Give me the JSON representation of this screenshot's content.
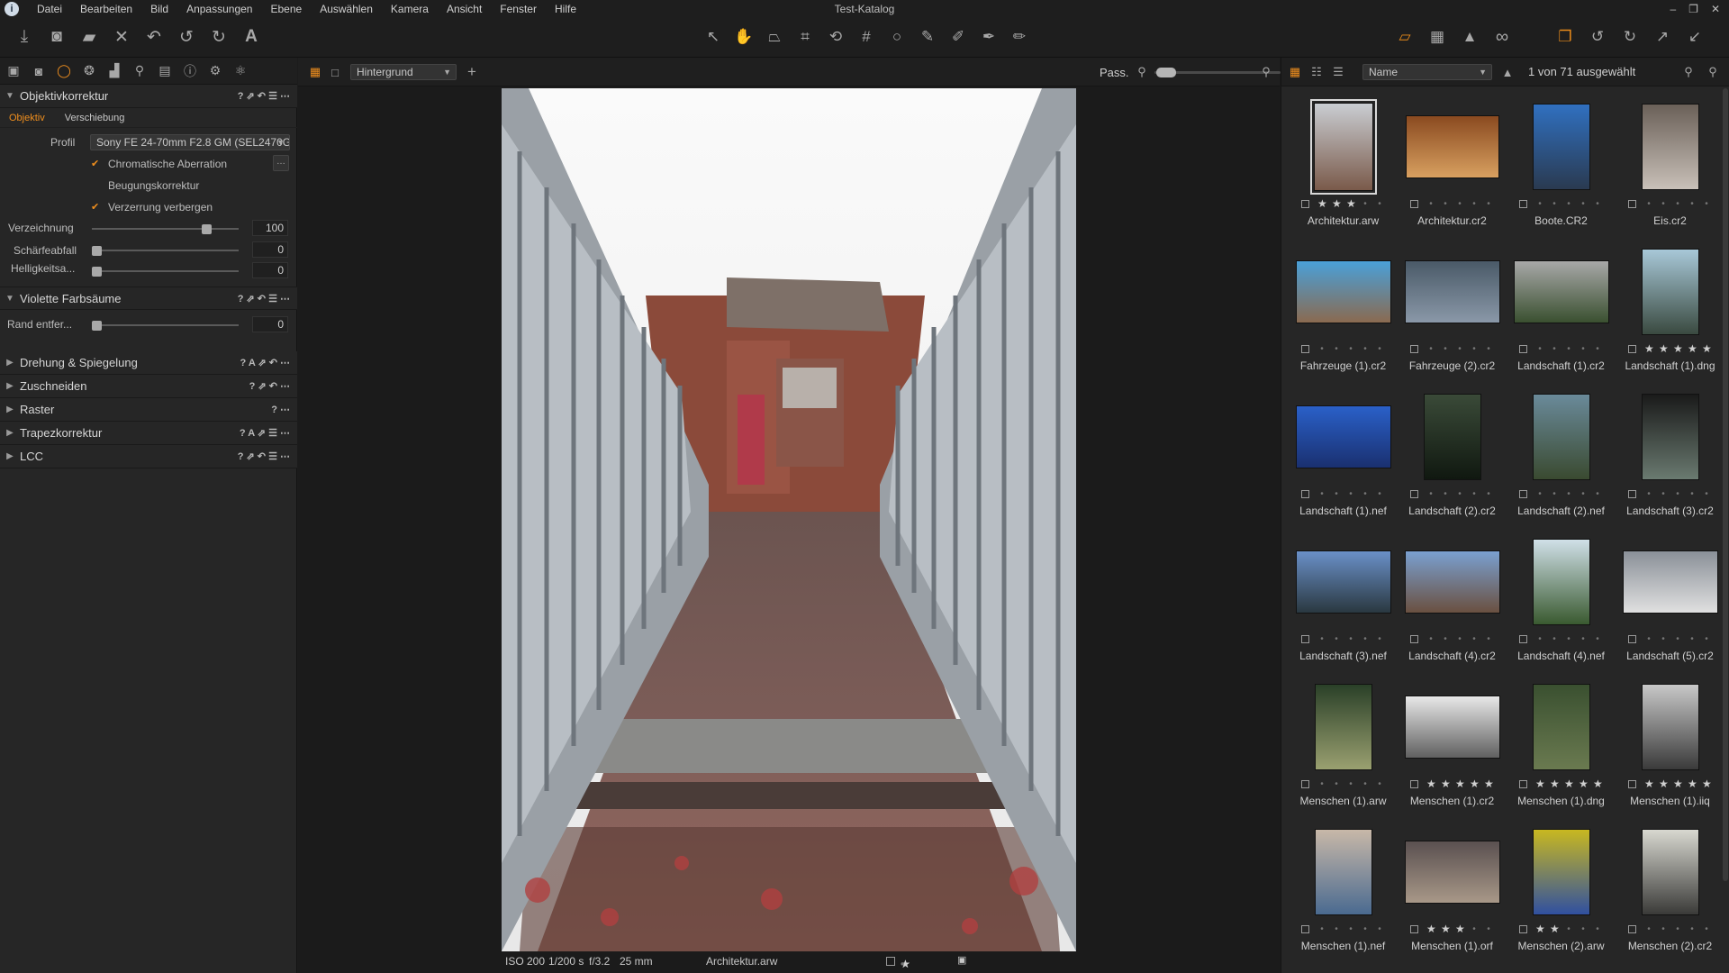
{
  "window": {
    "title": "Test-Katalog",
    "min_glyph": "–",
    "max_glyph": "❐",
    "close_glyph": "✕"
  },
  "menu": [
    "Datei",
    "Bearbeiten",
    "Bild",
    "Anpassungen",
    "Ebene",
    "Auswählen",
    "Kamera",
    "Ansicht",
    "Fenster",
    "Hilfe"
  ],
  "left": {
    "lens_section": {
      "title": "Objektivkorrektur",
      "icons": "?  ⇗  ↶  ☰  ⋯"
    },
    "subtabs": [
      "Objektiv",
      "Verschiebung"
    ],
    "profile_label": "Profil",
    "profile_value": "Sony FE 24-70mm F2.8 GM (SEL2470GM)",
    "checks": [
      {
        "label": "Chromatische Aberration",
        "checked": true
      },
      {
        "label": "Beugungskorrektur",
        "checked": false
      },
      {
        "label": "Verzerrung verbergen",
        "checked": true
      }
    ],
    "more_button": "…",
    "sliders": [
      {
        "label": "Verzeichnung",
        "value": "100",
        "pos": 0.8
      },
      {
        "label": "Schärfeabfall",
        "value": "0",
        "pos": 0.0
      },
      {
        "label": "Helligkeitsa...",
        "value": "0",
        "pos": 0.0
      }
    ],
    "purple_section": {
      "title": "Violette Farbsäume",
      "icons": "?  ⇗  ↶  ☰  ⋯"
    },
    "purple_slider": {
      "label": "Rand entfer...",
      "value": "0",
      "pos": 0.0
    },
    "other_sections": [
      {
        "title": "Drehung & Spiegelung",
        "icons": "?  A  ⇗  ↶  ⋯"
      },
      {
        "title": "Zuschneiden",
        "icons": "?  ⇗  ↶  ⋯"
      },
      {
        "title": "Raster",
        "icons": "?  ⋯"
      },
      {
        "title": "Trapezkorrektur",
        "icons": "?  A  ⇗  ☰  ⋯"
      },
      {
        "title": "LCC",
        "icons": "?  ⇗  ↶  ☰  ⋯"
      }
    ]
  },
  "viewer": {
    "layer": "Hintergrund",
    "fit_label": "Pass.",
    "status": {
      "iso": "ISO 200",
      "shutter": "1/200 s",
      "aperture": "f/3.2",
      "focal": "25 mm",
      "filename": "Architektur.arw",
      "stars": 3
    }
  },
  "browser": {
    "sort": "Name",
    "count": "1 von 71 ausgewählt",
    "items": [
      {
        "name": "Architektur.arw",
        "stars": 3,
        "selected": true,
        "w": 66,
        "h": 98,
        "c1": "#c9cdd2",
        "c2": "#7a5a4a"
      },
      {
        "name": "Architektur.cr2",
        "stars": 0,
        "w": 104,
        "h": 70,
        "c1": "#8a4a20",
        "c2": "#d8a060"
      },
      {
        "name": "Boote.CR2",
        "stars": 0,
        "w": 64,
        "h": 96,
        "c1": "#3070c0",
        "c2": "#2a3a50"
      },
      {
        "name": "Eis.cr2",
        "stars": 0,
        "w": 64,
        "h": 96,
        "c1": "#6a6058",
        "c2": "#c8c0b8"
      },
      {
        "name": "Fahrzeuge (1).cr2",
        "stars": 0,
        "w": 106,
        "h": 70,
        "c1": "#4aa0d8",
        "c2": "#8a6a50"
      },
      {
        "name": "Fahrzeuge (2).cr2",
        "stars": 0,
        "w": 106,
        "h": 70,
        "c1": "#4a5a68",
        "c2": "#8a98a8"
      },
      {
        "name": "Landschaft (1).cr2",
        "stars": 0,
        "w": 106,
        "h": 70,
        "c1": "#a8a8a8",
        "c2": "#3a5030"
      },
      {
        "name": "Landschaft (1).dng",
        "stars": 5,
        "w": 64,
        "h": 96,
        "c1": "#a8c8d8",
        "c2": "#3a4a40"
      },
      {
        "name": "Landschaft (1).nef",
        "stars": 0,
        "w": 106,
        "h": 70,
        "c1": "#2a60c8",
        "c2": "#1a3070"
      },
      {
        "name": "Landschaft (2).cr2",
        "stars": 0,
        "w": 64,
        "h": 96,
        "c1": "#3a4a38",
        "c2": "#101810"
      },
      {
        "name": "Landschaft (2).nef",
        "stars": 0,
        "w": 64,
        "h": 96,
        "c1": "#6a8a9a",
        "c2": "#3a4a30"
      },
      {
        "name": "Landschaft (3).cr2",
        "stars": 0,
        "w": 64,
        "h": 96,
        "c1": "#1a1a1a",
        "c2": "#6a7a70"
      },
      {
        "name": "Landschaft (3).nef",
        "stars": 0,
        "w": 106,
        "h": 70,
        "c1": "#6a90c8",
        "c2": "#2a3840"
      },
      {
        "name": "Landschaft (4).cr2",
        "stars": 0,
        "w": 106,
        "h": 70,
        "c1": "#7aa0d0",
        "c2": "#6a5040"
      },
      {
        "name": "Landschaft (4).nef",
        "stars": 0,
        "w": 64,
        "h": 96,
        "c1": "#d0e0e8",
        "c2": "#3a5a30"
      },
      {
        "name": "Landschaft (5).cr2",
        "stars": 0,
        "w": 106,
        "h": 70,
        "c1": "#8a9098",
        "c2": "#e0e0e0"
      },
      {
        "name": "Menschen (1).arw",
        "stars": 0,
        "w": 64,
        "h": 96,
        "c1": "#2a4028",
        "c2": "#9aa070"
      },
      {
        "name": "Menschen (1).cr2",
        "stars": 5,
        "w": 106,
        "h": 70,
        "c1": "#e8e8e8",
        "c2": "#606060"
      },
      {
        "name": "Menschen (1).dng",
        "stars": 5,
        "w": 64,
        "h": 96,
        "c1": "#3a5030",
        "c2": "#6a7a50"
      },
      {
        "name": "Menschen (1).iiq",
        "stars": 5,
        "w": 64,
        "h": 96,
        "c1": "#c8c8c8",
        "c2": "#3a3a3a"
      },
      {
        "name": "Menschen (1).nef",
        "stars": 0,
        "w": 64,
        "h": 96,
        "c1": "#c8b8a8",
        "c2": "#4a6a90"
      },
      {
        "name": "Menschen (1).orf",
        "stars": 3,
        "w": 106,
        "h": 70,
        "c1": "#5a5050",
        "c2": "#a89888"
      },
      {
        "name": "Menschen (2).arw",
        "stars": 2,
        "w": 64,
        "h": 96,
        "c1": "#c8b820",
        "c2": "#3050a0"
      },
      {
        "name": "Menschen (2).cr2",
        "stars": 0,
        "w": 64,
        "h": 96,
        "c1": "#d8d8d0",
        "c2": "#3a3a38"
      }
    ]
  }
}
